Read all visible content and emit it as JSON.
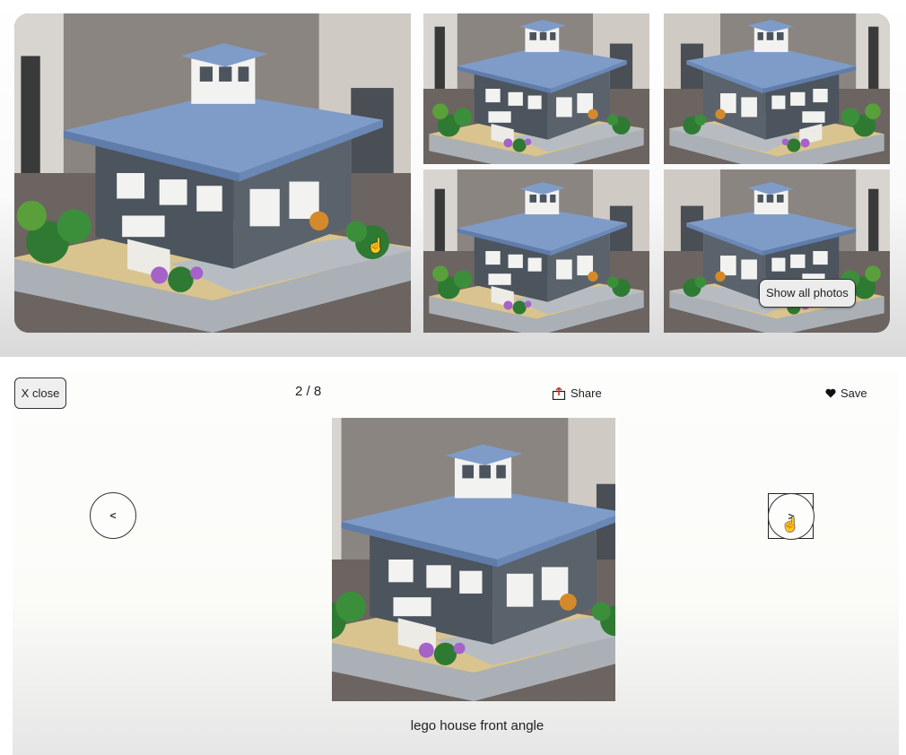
{
  "gallery": {
    "show_all_label": "Show all photos",
    "photos": [
      {
        "icon": "lego-house-photo",
        "view": "front-angle"
      },
      {
        "icon": "lego-house-photo",
        "view": "front-left"
      },
      {
        "icon": "lego-house-photo",
        "view": "side-garden"
      },
      {
        "icon": "lego-house-photo",
        "view": "back-deck"
      },
      {
        "icon": "lego-house-photo",
        "view": "right-side"
      }
    ]
  },
  "lightbox": {
    "close_label": "X close",
    "counter": "2 / 8",
    "share_label": "Share",
    "save_label": "Save",
    "prev_symbol": "<",
    "next_symbol": ">",
    "caption": "lego house front angle",
    "icons": {
      "share": "share-icon",
      "save": "heart-icon",
      "cursor": "hand-pointer-icon"
    }
  },
  "colors": {
    "roof": "#7f9cc9",
    "wall": "#4c545e",
    "trim": "#f2f2f0",
    "baseplate": "#d9c48f",
    "pavement": "#b6bcc2",
    "plants": "#2f7a32",
    "flowers": "#a562c9",
    "table": "#6b6461"
  }
}
